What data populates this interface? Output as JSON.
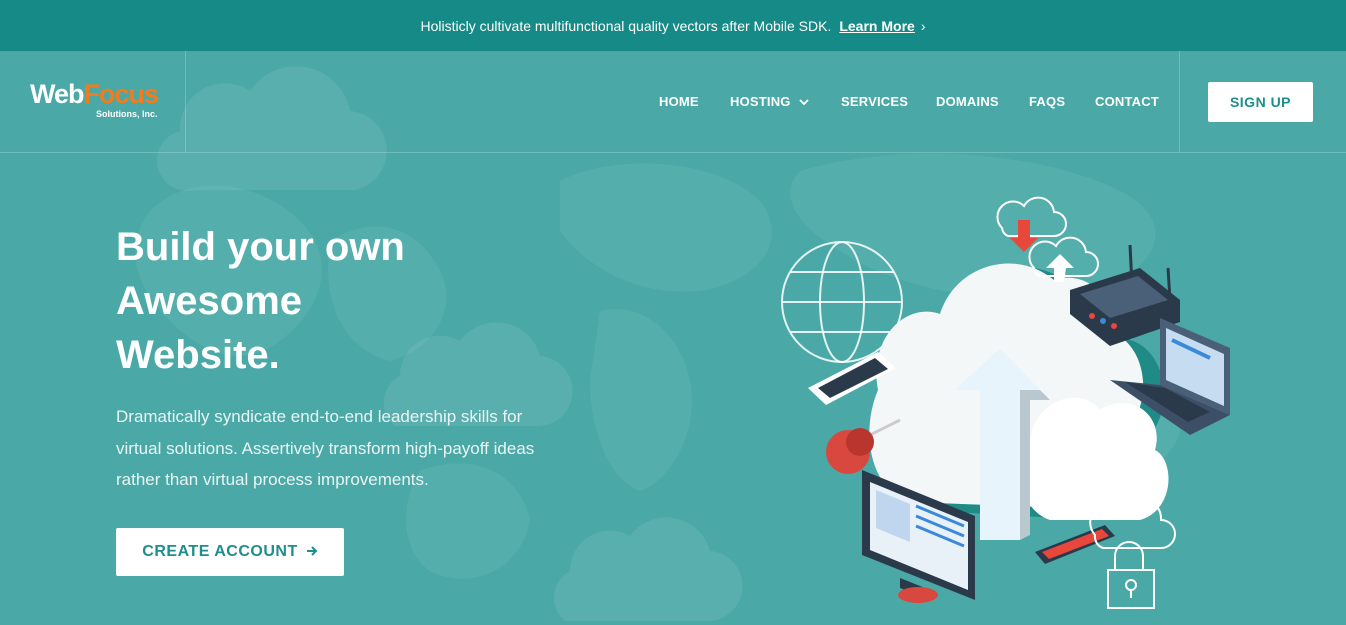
{
  "announcement": {
    "message": "Holisticly cultivate multifunctional quality vectors after Mobile SDK.",
    "link_label": "Learn More",
    "link_icon": "chevron-right-icon"
  },
  "logo": {
    "part1": "Web",
    "part2": "Focus",
    "subtitle": "Solutions, Inc."
  },
  "nav": {
    "items": [
      {
        "label": "HOME"
      },
      {
        "label": "HOSTING",
        "icon": "chevron-down-icon"
      },
      {
        "label": "SERVICES"
      },
      {
        "label": "DOMAINS"
      },
      {
        "label": "FAQS"
      },
      {
        "label": "CONTACT"
      }
    ],
    "signup_label": "SIGN UP"
  },
  "hero": {
    "headline_line1": "Build your own",
    "headline_line2": "Awesome",
    "headline_line3": "Website.",
    "description": "Dramatically syndicate end-to-end leadership skills for virtual solutions. Assertively transform high-payoff ideas rather than virtual process improvements.",
    "cta_label": "CREATE ACCOUNT",
    "cta_icon": "arrow-right-icon"
  },
  "colors": {
    "topbar": "#168a86",
    "hero_bg": "#4aa9a7",
    "accent_text": "#1d8e8b",
    "logo_orange": "#f07c1d"
  }
}
